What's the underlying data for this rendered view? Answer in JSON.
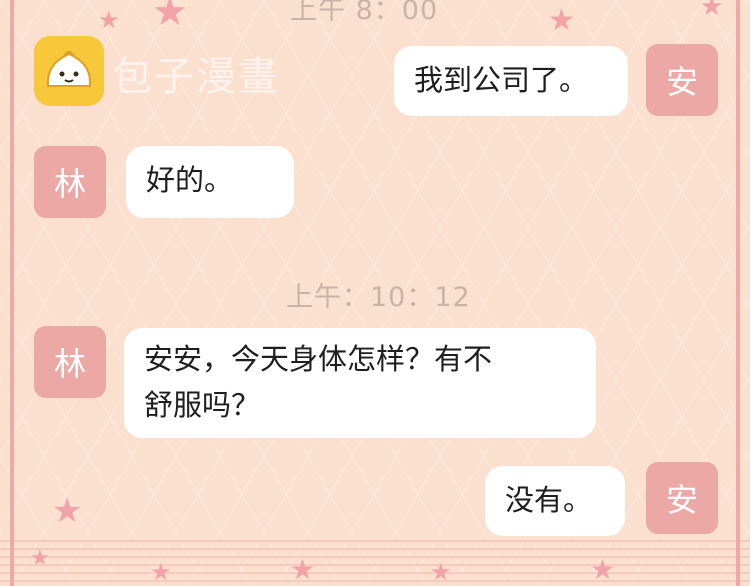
{
  "watermark": {
    "logo_icon": "bun-icon",
    "text": "包子漫畫"
  },
  "timestamps": [
    "上午 8：00",
    "上午：10：12"
  ],
  "avatars": {
    "an": "安",
    "lin": "林"
  },
  "messages": [
    {
      "sender": "安",
      "side": "right",
      "text": "我到公司了。"
    },
    {
      "sender": "林",
      "side": "left",
      "text": "好的。"
    },
    {
      "sender": "林",
      "side": "left",
      "text_line1": "安安，今天身体怎样？有不",
      "text_line2": "舒服吗？"
    },
    {
      "sender": "安",
      "side": "right",
      "text": "没有。"
    }
  ],
  "colors": {
    "background": "#fbdfcf",
    "avatar": "#eca8a5",
    "bubble": "#ffffff",
    "star": "#f2a3a8",
    "timestamp": "#c9b3a6"
  }
}
